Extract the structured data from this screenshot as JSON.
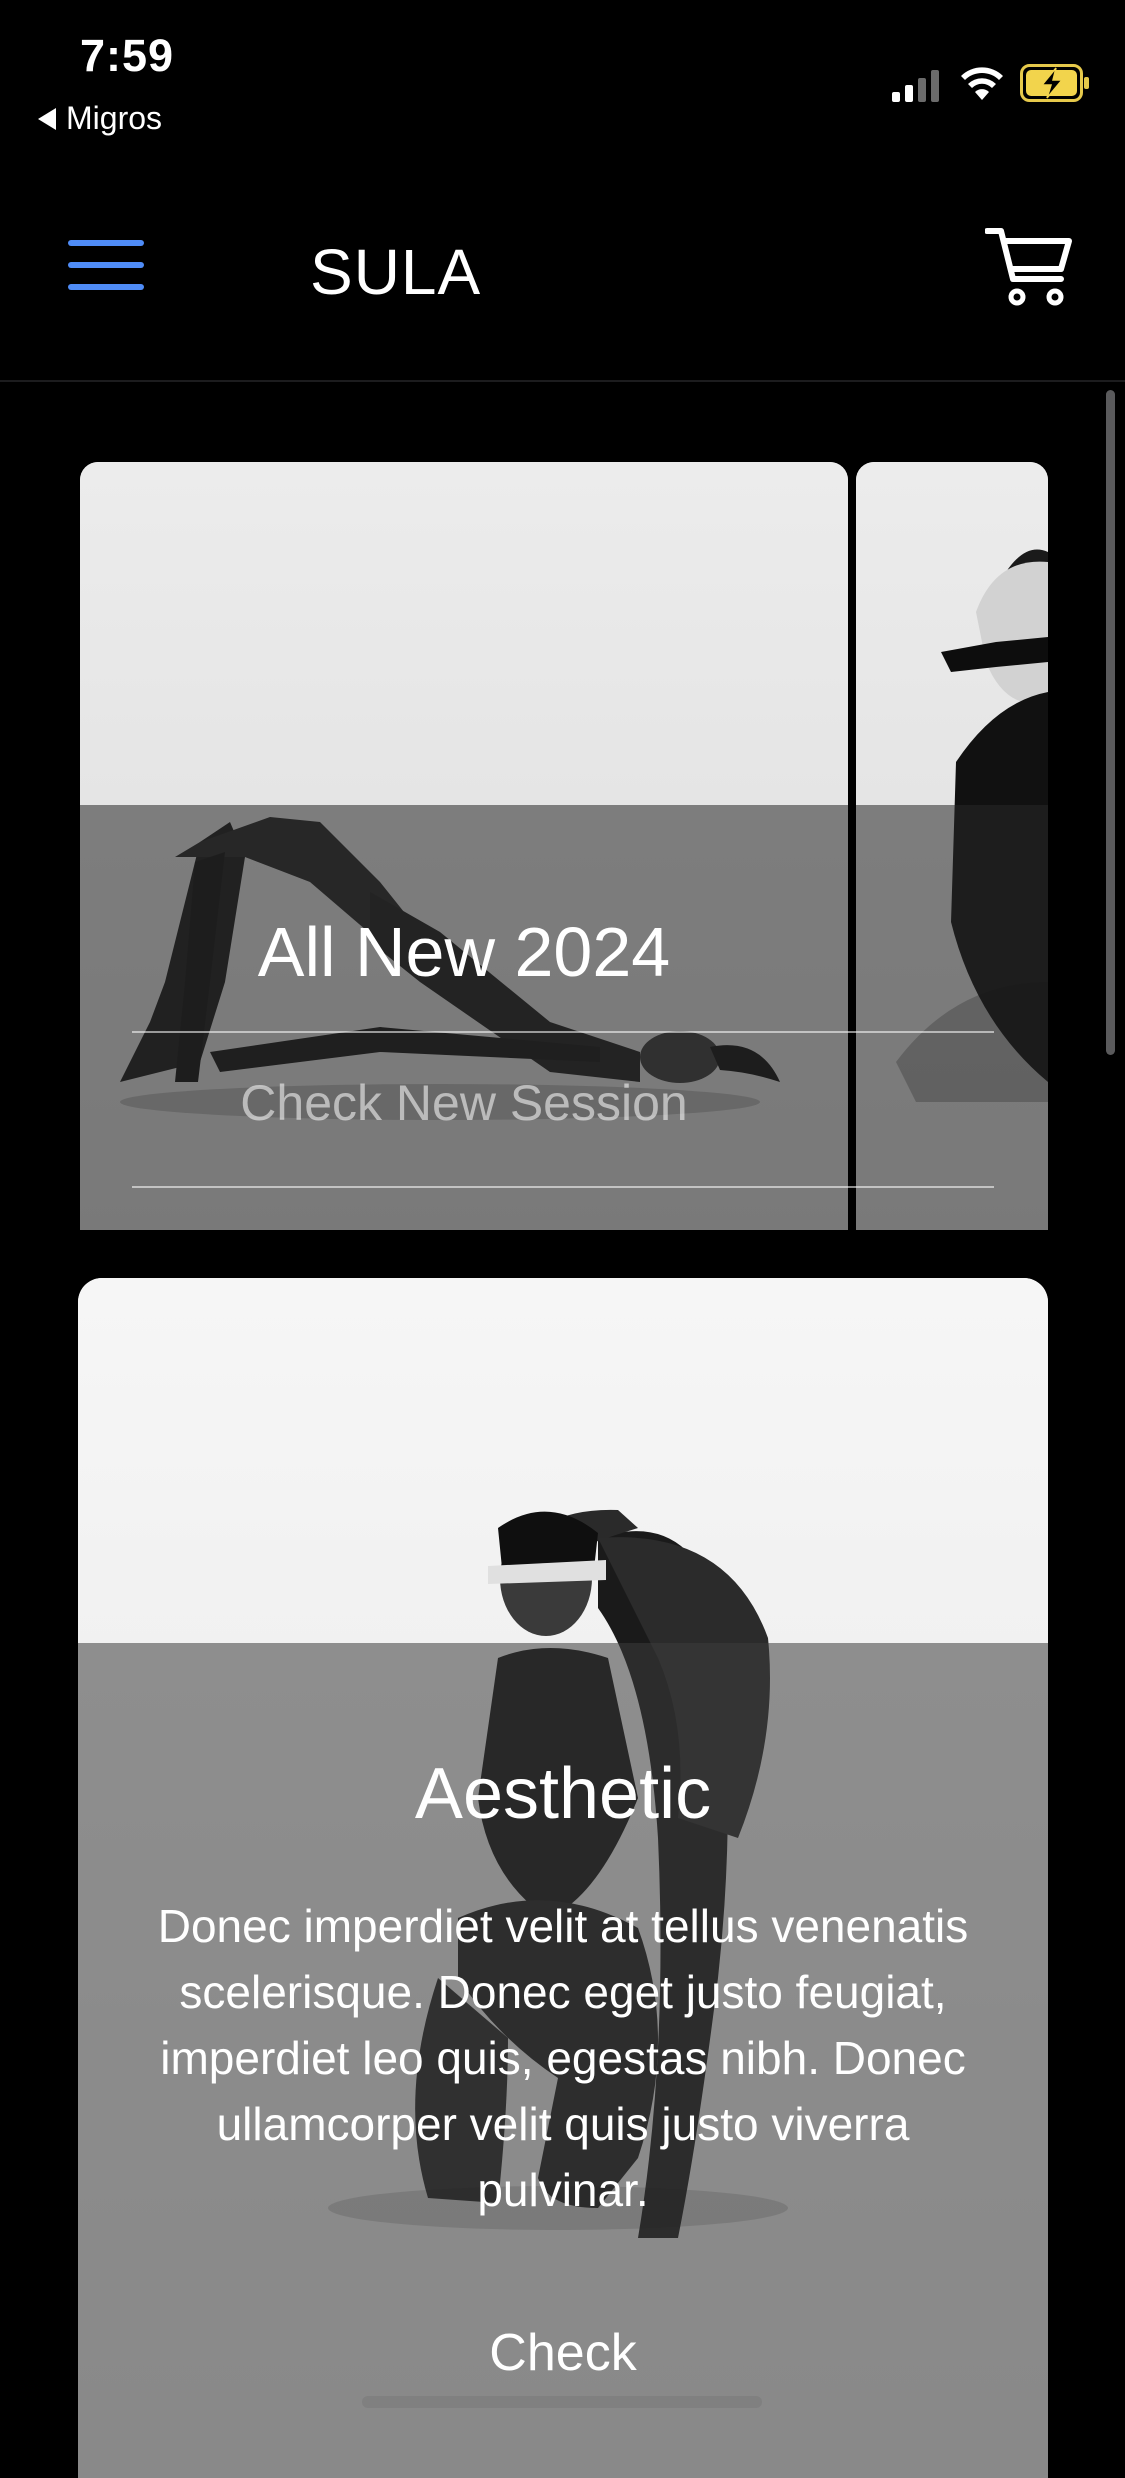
{
  "status_bar": {
    "time": "7:59",
    "back_app": "Migros"
  },
  "header": {
    "title": "SULA",
    "accent_color": "#4f8cf7"
  },
  "carousel": {
    "slides": [
      {
        "title": "All New 2024",
        "link_label": "Check New Session"
      }
    ]
  },
  "feature": {
    "title": "Aesthetic",
    "description": "Donec imperdiet velit at tellus venenatis scelerisque. Donec eget justo feugiat, imperdiet leo quis, egestas nibh. Donec ullamcorper velit quis justo viverra pulvinar.",
    "link_label": "Check"
  },
  "icons": {
    "menu": "hamburger-menu-icon",
    "cart": "shopping-cart-icon",
    "signal": "cellular-signal-icon",
    "wifi": "wifi-icon",
    "battery": "battery-charging-icon"
  }
}
